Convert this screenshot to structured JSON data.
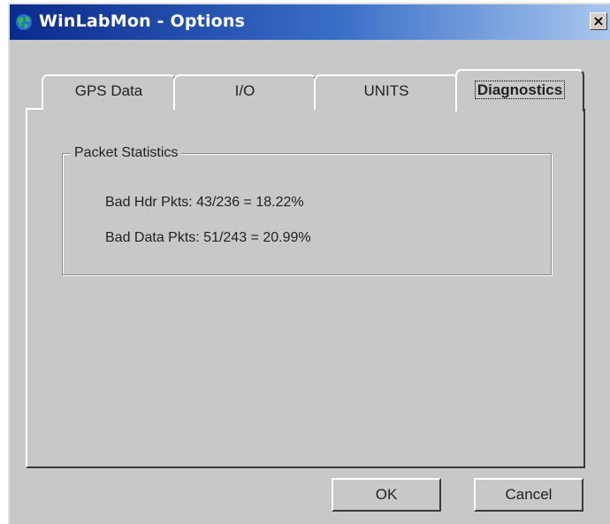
{
  "window": {
    "title": "WinLabMon - Options",
    "close_glyph": "×",
    "app_icon": "winlabmon-globe-icon"
  },
  "tabs": [
    {
      "label": "GPS Data",
      "active": false
    },
    {
      "label": "I/O",
      "active": false
    },
    {
      "label": "UNITS",
      "active": false
    },
    {
      "label": "Diagnostics",
      "active": true
    }
  ],
  "diagnostics": {
    "group_title": "Packet Statistics",
    "bad_hdr": "Bad Hdr Pkts: 43/236 = 18.22%",
    "bad_data": "Bad Data Pkts: 51/243 = 20.99%"
  },
  "buttons": {
    "ok": "OK",
    "cancel": "Cancel"
  },
  "colors": {
    "title_gradient_start": "#0a2a8c",
    "title_gradient_end": "#a9c7ee",
    "dialog_face": "#c8c8c8"
  }
}
